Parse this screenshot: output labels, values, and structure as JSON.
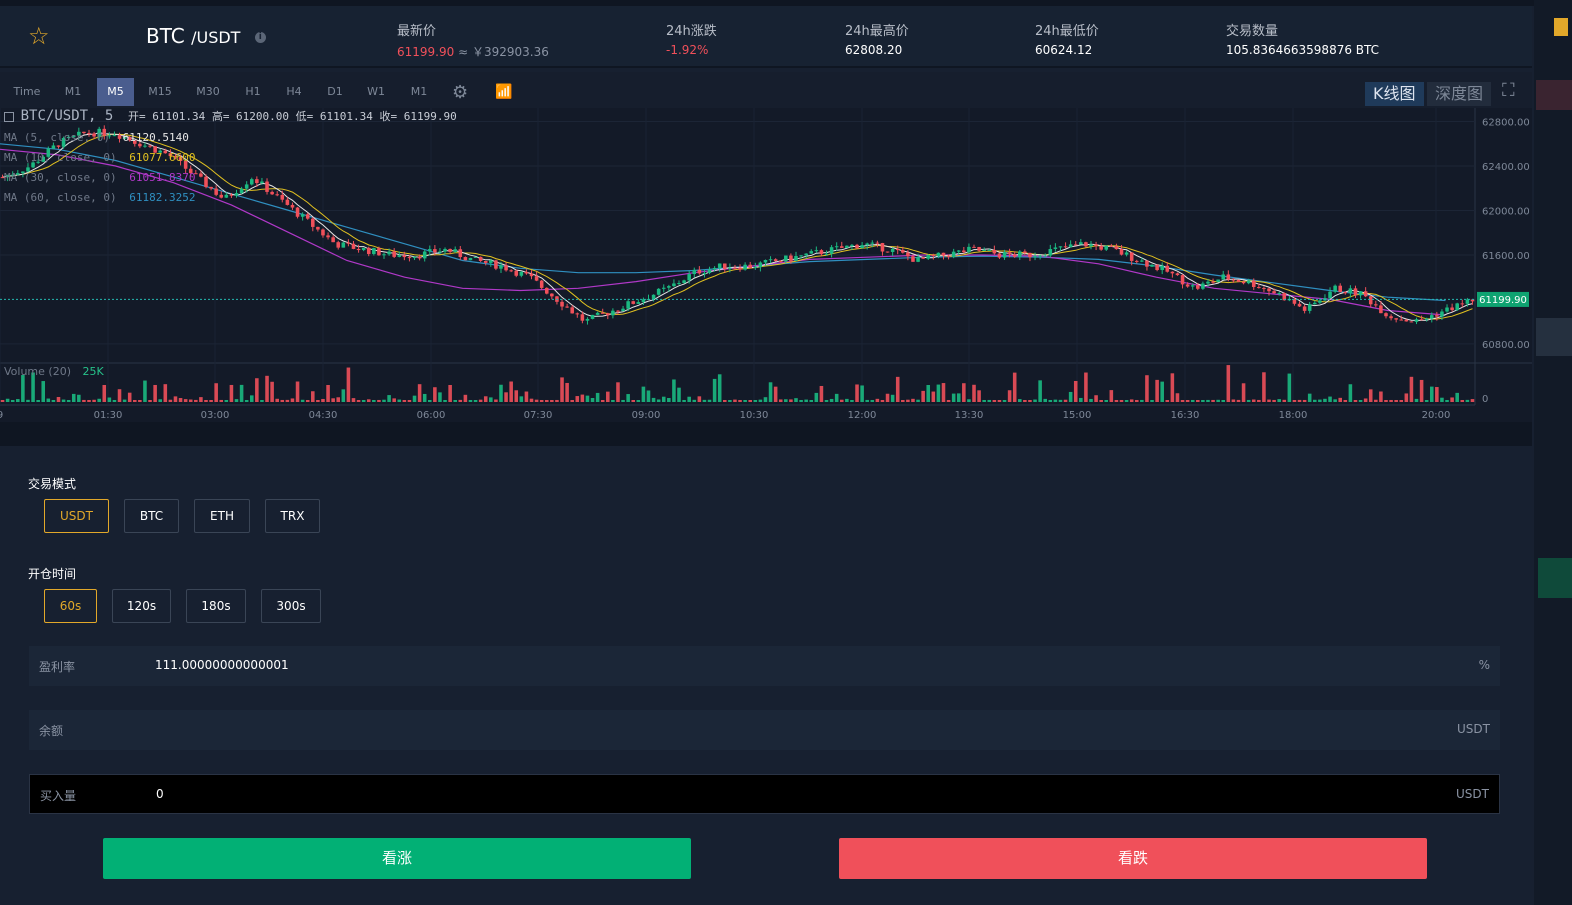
{
  "header": {
    "pair_base": "BTC",
    "pair_quote": "/USDT",
    "info_glyph": "i",
    "star_glyph": "☆",
    "stats": [
      {
        "label": "最新价",
        "value": "61199.90",
        "value_extra": " ≈ ￥392903.36",
        "color": "#f0505a"
      },
      {
        "label": "24h涨跌",
        "value": "-1.92%",
        "color": "#f0505a"
      },
      {
        "label": "24h最高价",
        "value": "62808.20"
      },
      {
        "label": "24h最低价",
        "value": "60624.12"
      },
      {
        "label": "交易数量",
        "value": "105.8364663598876 BTC"
      }
    ]
  },
  "toolbar": {
    "intervals": [
      "Time",
      "M1",
      "M5",
      "M15",
      "M30",
      "H1",
      "H4",
      "D1",
      "W1",
      "M1"
    ],
    "active_interval": "M5",
    "settings_icon": "⚙",
    "indicator_icon": "📶",
    "fullscreen_icon": "⛶",
    "tabs": [
      "K线图",
      "深度图"
    ]
  },
  "legend": {
    "title": "BTC/USDT, 5",
    "ohlc": "开= 61101.34 高= 61200.00 低= 61101.34 收= 61199.90",
    "mas": [
      {
        "label": "MA (5, close, 0)",
        "value": "61120.5140",
        "color": "#e6e6e6"
      },
      {
        "label": "MA (10, close, 0)",
        "value": "61077.6600",
        "color": "#e0c020"
      },
      {
        "label": "MA (30, close, 0)",
        "value": "61051.8370",
        "color": "#b038c8"
      },
      {
        "label": "MA (60, close, 0)",
        "value": "61182.3252",
        "color": "#2f8fc0"
      }
    ],
    "volume_label": "Volume (20)",
    "volume_value": "25K"
  },
  "chart_data": {
    "type": "candlestick",
    "y_ticks": [
      "62800.00",
      "62400.00",
      "62000.00",
      "61600.00",
      "60800.00"
    ],
    "ylim": [
      60624,
      62808
    ],
    "current_price": "61199.90",
    "x_ticks": [
      "9",
      "01:30",
      "03:00",
      "04:30",
      "06:00",
      "07:30",
      "09:00",
      "10:30",
      "12:00",
      "13:30",
      "15:00",
      "16:30",
      "18:00",
      "20:00"
    ],
    "volume_axis_label": "0",
    "close_path": [
      62300,
      62400,
      62600,
      62700,
      62700,
      62600,
      62500,
      62300,
      62100,
      62300,
      62100,
      61900,
      61700,
      61650,
      61600,
      61600,
      61650,
      61550,
      61500,
      61400,
      61200,
      61000,
      61100,
      61200,
      61300,
      61450,
      61500,
      61500,
      61550,
      61600,
      61650,
      61700,
      61650,
      61550,
      61600,
      61650,
      61600,
      61600,
      61650,
      61700,
      61650,
      61550,
      61450,
      61300,
      61400,
      61350,
      61250,
      61100,
      61300,
      61250,
      61050,
      61000,
      61100,
      61200
    ],
    "ma60_path": [
      62600,
      62550,
      62450,
      62300,
      62150,
      62000,
      61850,
      61700,
      61550,
      61480,
      61440,
      61440,
      61460,
      61500,
      61540,
      61560,
      61580,
      61590,
      61580,
      61560,
      61500,
      61420,
      61350,
      61280,
      61220,
      61190
    ],
    "ma30_path": [
      62550,
      62500,
      62400,
      62250,
      62050,
      61800,
      61550,
      61400,
      61300,
      61280,
      61300,
      61360,
      61440,
      61500,
      61560,
      61580,
      61600,
      61600,
      61590,
      61520,
      61400,
      61300,
      61250,
      61200,
      61100,
      61060
    ]
  },
  "form": {
    "mode_label": "交易模式",
    "modes": [
      "USDT",
      "BTC",
      "ETH",
      "TRX"
    ],
    "selected_mode": "USDT",
    "time_label": "开仓时间",
    "times": [
      "60s",
      "120s",
      "180s",
      "300s"
    ],
    "selected_time": "60s",
    "rate_label": "盈利率",
    "rate_value": "111.00000000000001",
    "rate_unit": "%",
    "balance_label": "余额",
    "balance_unit": "USDT",
    "amount_label": "买入量",
    "amount_value": "0",
    "amount_unit": "USDT",
    "buy_up": "看涨",
    "buy_down": "看跌",
    "up_color": "#02b075",
    "down_color": "#f0505a"
  }
}
